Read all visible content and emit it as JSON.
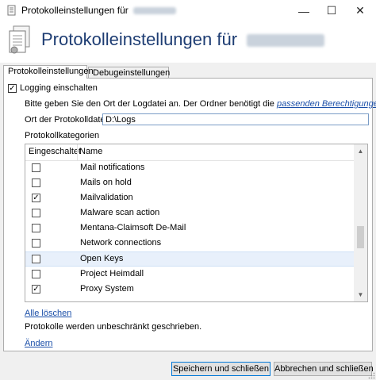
{
  "window": {
    "title": "Protokolleinstellungen für",
    "minimize_label": "—",
    "maximize_label": "☐",
    "close_label": "✕"
  },
  "header": {
    "title": "Protokolleinstellungen für"
  },
  "tabs": [
    {
      "label": "Protokolleinstellungen",
      "active": true
    },
    {
      "label": "Debugeinstellungen",
      "active": false
    }
  ],
  "logging": {
    "enable_label": "Logging einschalten",
    "enabled": true,
    "info_text": "Bitte geben Sie den Ort der Logdatei an. Der Ordner benötigt die",
    "permissions_link": "passenden Berechtigungen",
    "info_suffix": ".",
    "path_label": "Ort der Protokolldatei",
    "path_value": "D:\\Logs"
  },
  "categories": {
    "section_label": "Protokollkategorien",
    "columns": [
      "Eingeschaltet",
      "Name"
    ],
    "rows": [
      {
        "name": "Mail notifications",
        "checked": false,
        "selected": false
      },
      {
        "name": "Mails on hold",
        "checked": false,
        "selected": false
      },
      {
        "name": "Mailvalidation",
        "checked": true,
        "selected": false
      },
      {
        "name": "Malware scan action",
        "checked": false,
        "selected": false
      },
      {
        "name": "Mentana-Claimsoft De-Mail",
        "checked": false,
        "selected": false
      },
      {
        "name": "Network connections",
        "checked": false,
        "selected": false
      },
      {
        "name": "Open Keys",
        "checked": false,
        "selected": true
      },
      {
        "name": "Project Heimdall",
        "checked": false,
        "selected": false
      },
      {
        "name": "Proxy System",
        "checked": true,
        "selected": false
      }
    ]
  },
  "clear_all_link": "Alle löschen",
  "retention_text": "Protokolle werden unbeschränkt geschrieben.",
  "change_link": "Ändern",
  "buttons": {
    "save": "Speichern und schließen",
    "cancel": "Abbrechen und schließen"
  }
}
